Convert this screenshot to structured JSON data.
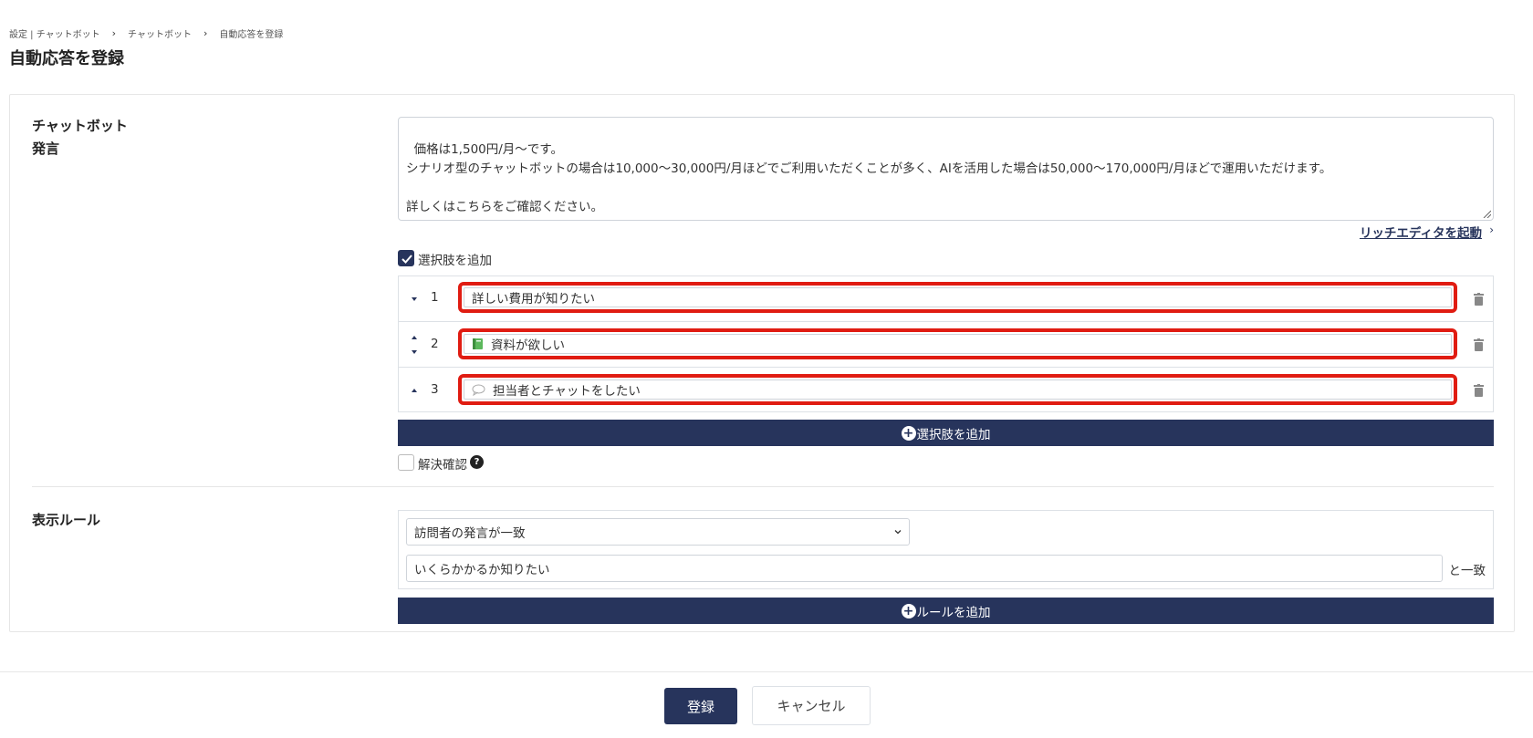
{
  "breadcrumb": {
    "item1": "設定 | チャットボット",
    "item2": "チャットボット",
    "item3": "自動応答を登録",
    "separator": "›"
  },
  "page_title": "自動応答を登録",
  "chatbot_message": {
    "label_line1": "チャットボット",
    "label_line2": "発言",
    "text": "価格は1,500円/月～です。\nシナリオ型のチャットボットの場合は10,000～30,000円/月ほどでご利用いただくことが多く、AIを活用した場合は50,000～170,000円/月ほどで運用いただけます。\n\n詳しくはこちらをご確認ください。",
    "rich_editor_link": "リッチエディタを起動",
    "rich_editor_chevron": "›"
  },
  "choices": {
    "checkbox_label": "選択肢を追加",
    "checked": true,
    "items": [
      {
        "number": "1",
        "icon": "",
        "text": "詳しい費用が知りたい"
      },
      {
        "number": "2",
        "icon": "green-book-icon",
        "text": "資料が欲しい"
      },
      {
        "number": "3",
        "icon": "speech-bubble-icon",
        "text": "担当者とチャットをしたい"
      }
    ],
    "add_button": "選択肢を追加",
    "add_icon_glyph": "+"
  },
  "resolution": {
    "label": "解決確認",
    "checked": false,
    "help_glyph": "?"
  },
  "display_rule": {
    "label": "表示ルール",
    "select_value": "訪問者の発言が一致",
    "input_value": "いくらかかるか知りたい",
    "suffix": "と一致",
    "add_button": "ルールを追加",
    "add_icon_glyph": "+"
  },
  "footer": {
    "submit": "登録",
    "cancel": "キャンセル"
  },
  "colors": {
    "primary": "#27345c",
    "highlight": "#e01c12"
  }
}
